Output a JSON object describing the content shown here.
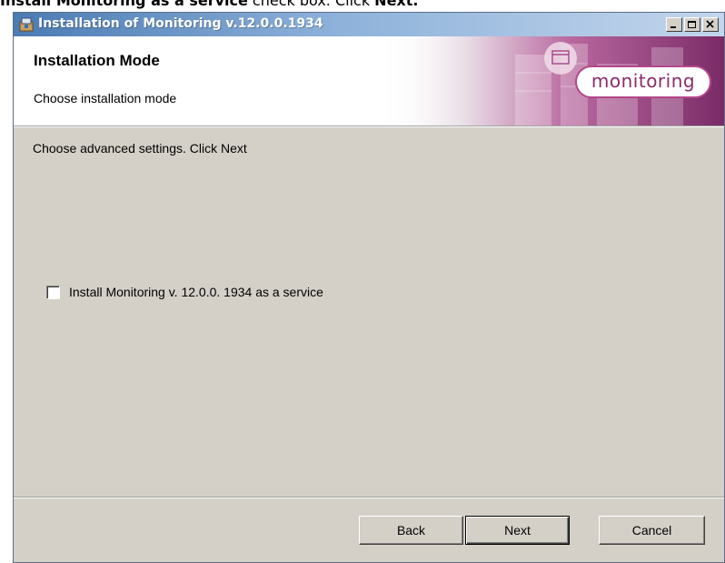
{
  "caption": {
    "bold_part": "Install Monitoring as a service",
    "text_part": " check box. Click ",
    "bold_end": "Next."
  },
  "window": {
    "title": "Installation of Monitoring v.12.0.0.1934",
    "controls": [
      "minimize-icon",
      "maximize-icon",
      "close-icon"
    ]
  },
  "header": {
    "title": "Installation Mode",
    "subtitle": "Choose installation mode",
    "logo_text": "monitoring"
  },
  "body": {
    "instruction": "Choose advanced settings. Click Next",
    "checkbox": {
      "label": "Install Monitoring v. 12.0.0. 1934 as a service",
      "checked": false
    }
  },
  "buttons": {
    "back": "Back",
    "next": "Next",
    "cancel": "Cancel"
  },
  "colors": {
    "dialog_face": "#d4d0c8",
    "title_gradient_start": "#4b7bb3",
    "logo_accent": "#b3478a"
  }
}
